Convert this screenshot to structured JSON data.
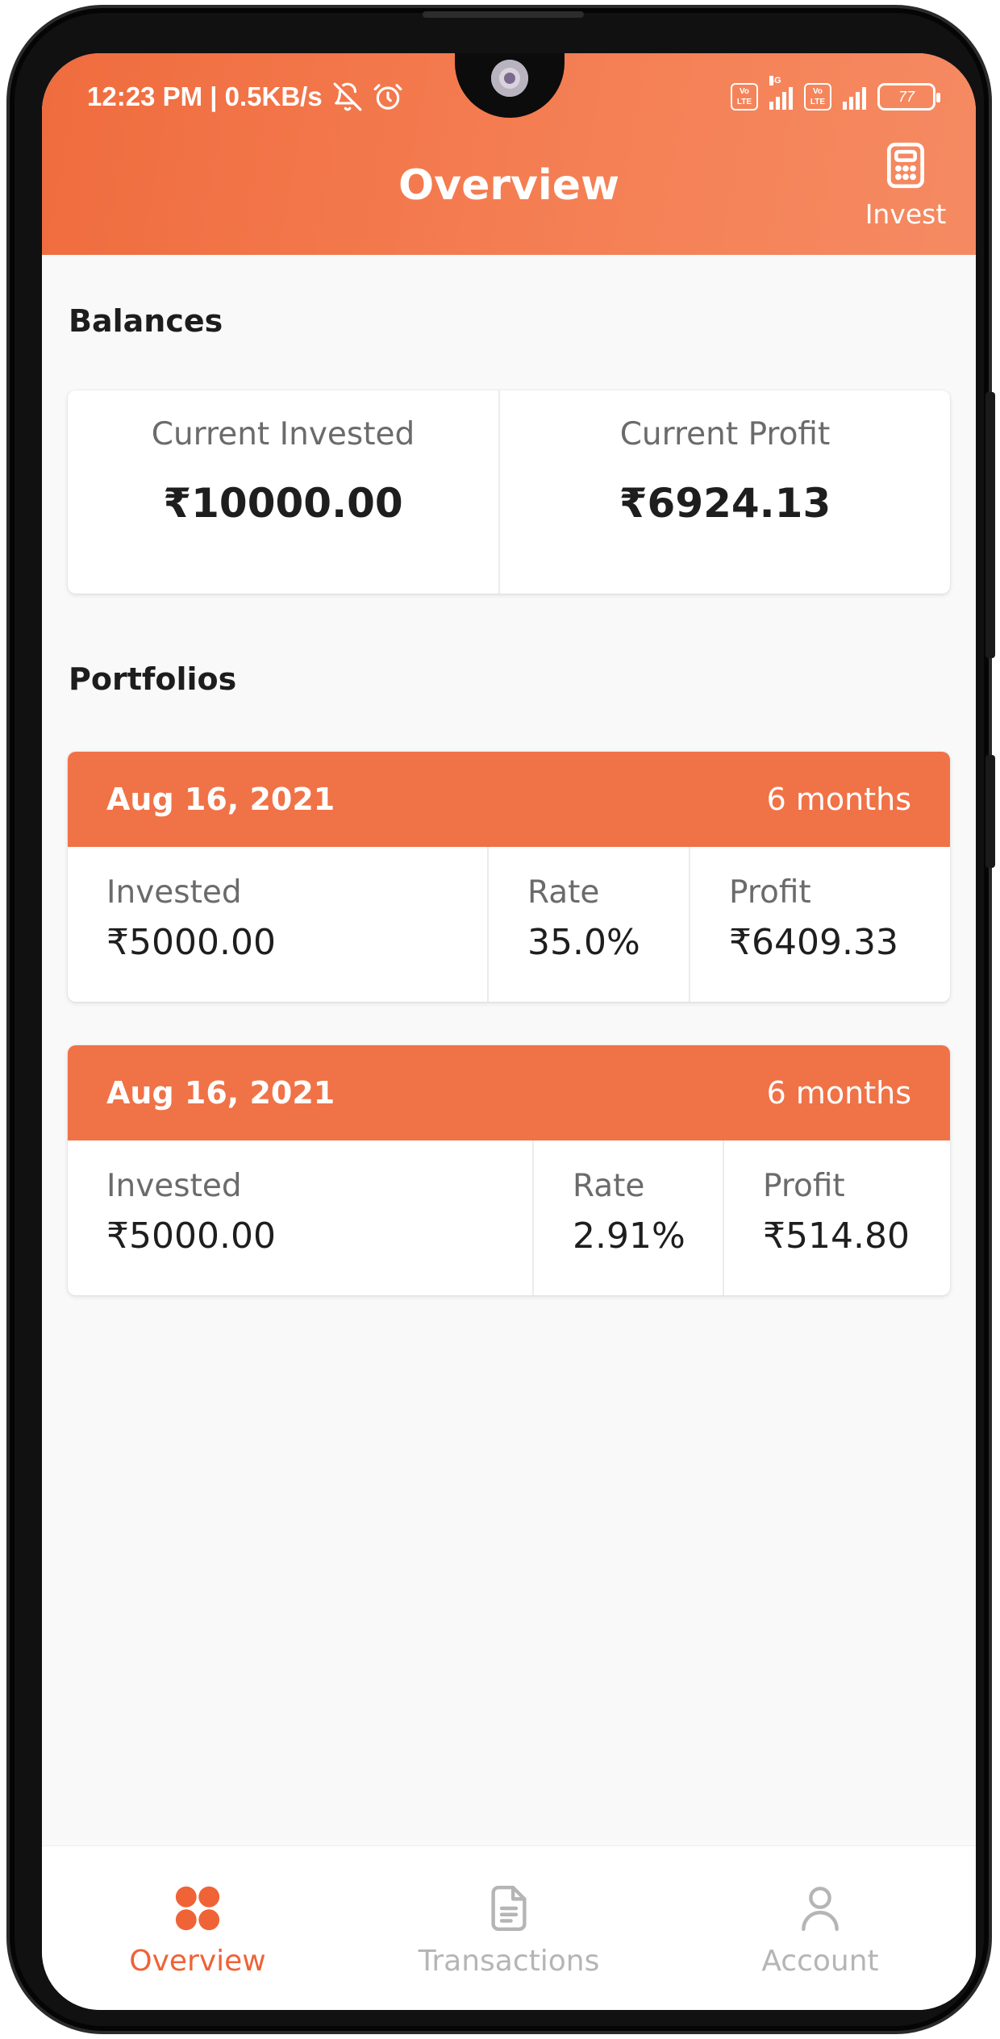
{
  "status_bar": {
    "time_speed": "12:23 PM | 0.5KB/s",
    "mute_icon": "bell-off-icon",
    "alarm_icon": "alarm-clock-icon",
    "volte1": "Vo LTE",
    "network": "4G",
    "volte2": "Vo LTE",
    "battery": "77"
  },
  "header": {
    "title": "Overview",
    "invest_label": "Invest",
    "invest_icon": "calculator-icon",
    "accent_color": "#f07247"
  },
  "balances": {
    "heading": "Balances",
    "current_invested_label": "Current Invested",
    "current_invested_value": "₹10000.00",
    "current_profit_label": "Current Profit",
    "current_profit_value": "₹6924.13"
  },
  "portfolios": {
    "heading": "Portfolios",
    "items": [
      {
        "date": "Aug 16, 2021",
        "duration": "6 months",
        "invested_label": "Invested",
        "invested_value": "₹5000.00",
        "rate_label": "Rate",
        "rate_value": "35.0%",
        "profit_label": "Profit",
        "profit_value": "₹6409.33"
      },
      {
        "date": "Aug 16, 2021",
        "duration": "6 months",
        "invested_label": "Invested",
        "invested_value": "₹5000.00",
        "rate_label": "Rate",
        "rate_value": "2.91%",
        "profit_label": "Profit",
        "profit_value": "₹514.80"
      }
    ]
  },
  "bottom_nav": {
    "items": [
      {
        "label": "Overview",
        "icon": "grid-icon",
        "active": true
      },
      {
        "label": "Transactions",
        "icon": "document-icon",
        "active": false
      },
      {
        "label": "Account",
        "icon": "user-icon",
        "active": false
      }
    ],
    "active_color": "#ef6337",
    "inactive_color": "#b5b5b5"
  }
}
